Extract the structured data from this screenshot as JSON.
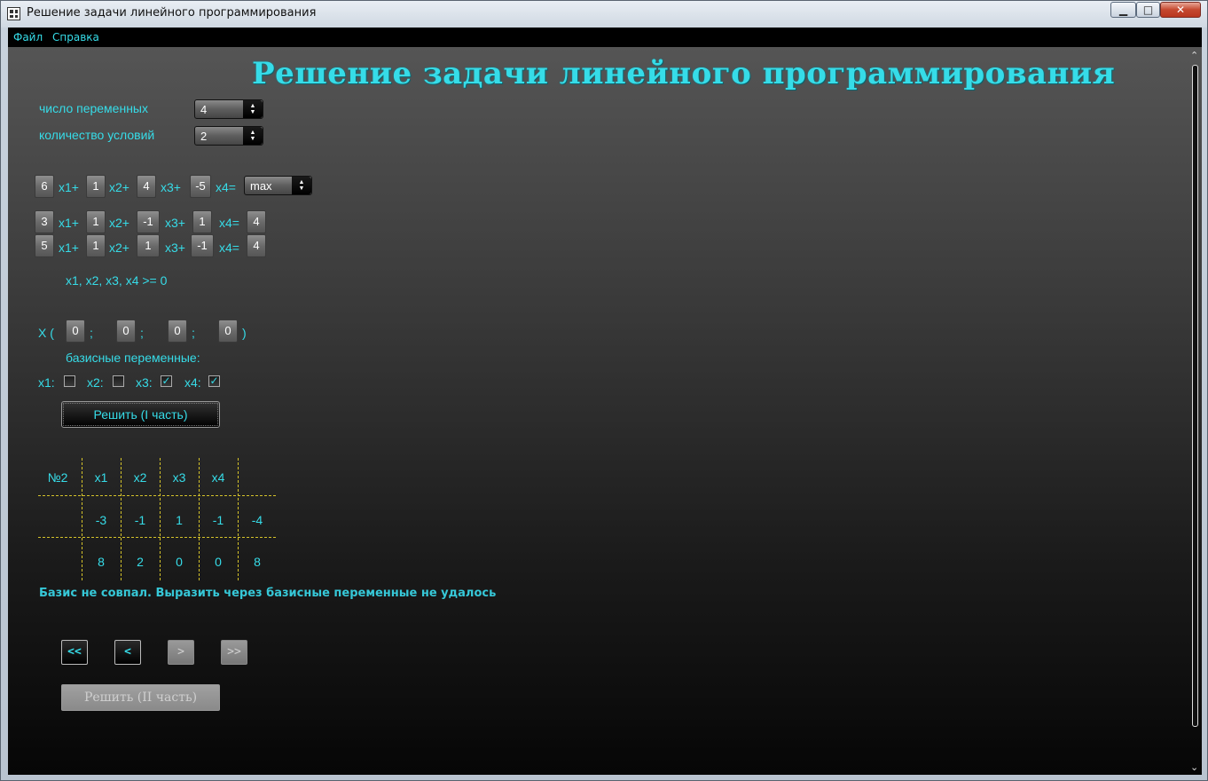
{
  "window": {
    "title": "Решение задачи линейного программирования",
    "controls": {
      "minimize": "▁",
      "maximize": "□",
      "close": "✕"
    }
  },
  "menu": {
    "items": [
      "Файл",
      "Справка"
    ]
  },
  "heading": "Решение задачи линейного программирования",
  "settings": {
    "variables_label": "число переменных",
    "variables_value": "4",
    "conditions_label": "количество условий",
    "conditions_value": "2"
  },
  "objective": {
    "coefficients": [
      "6",
      "1",
      "4",
      "-5"
    ],
    "terms": [
      "x1+",
      "x2+",
      "x3+",
      "x4="
    ],
    "goal": "max"
  },
  "constraints": [
    {
      "coefficients": [
        "3",
        "1",
        "-1",
        "1"
      ],
      "terms": [
        "x1+",
        "x2+",
        "x3+",
        "x4="
      ],
      "rhs": "4"
    },
    {
      "coefficients": [
        "5",
        "1",
        "1",
        "-1"
      ],
      "terms": [
        "x1+",
        "x2+",
        "x3+",
        "x4="
      ],
      "rhs": "4"
    }
  ],
  "nonneg_text": "x1, x2, x3, x4 >= 0",
  "initial_point": {
    "open": "X (",
    "values": [
      "0",
      "0",
      "0",
      "0"
    ],
    "sep": ";",
    "close": ")"
  },
  "basis": {
    "title": "базисные переменные:",
    "items": [
      {
        "label": "x1:",
        "checked": false
      },
      {
        "label": "x2:",
        "checked": false
      },
      {
        "label": "x3:",
        "checked": true
      },
      {
        "label": "x4:",
        "checked": true
      }
    ],
    "check_glyph": "✓"
  },
  "solve1_label": "Решить (I часть)",
  "table": {
    "corner": "№2",
    "headers": [
      "x1",
      "x2",
      "x3",
      "x4"
    ],
    "rows": [
      [
        "-3",
        "-1",
        "1",
        "-1",
        "-4"
      ],
      [
        "8",
        "2",
        "0",
        "0",
        "8"
      ]
    ]
  },
  "message": "Базис не совпал. Выразить через базисные переменные не удалось",
  "nav": {
    "first": "<<",
    "prev": "<",
    "next": ">",
    "last": ">>"
  },
  "solve2_label": "Решить (II часть)",
  "scroll": {
    "up": "⌃",
    "down": "⌄"
  }
}
